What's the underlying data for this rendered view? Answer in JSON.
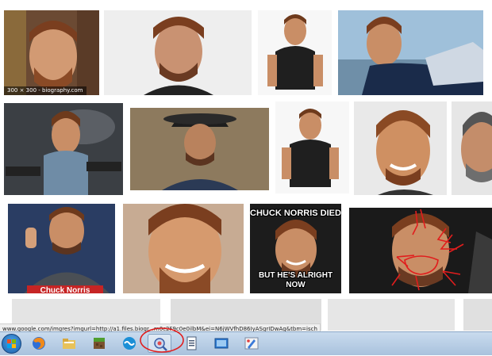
{
  "results": [
    {
      "id": "result-1",
      "caption": "300 × 300 - biography.com"
    },
    {
      "id": "result-2"
    },
    {
      "id": "result-3"
    },
    {
      "id": "result-4"
    },
    {
      "id": "result-5"
    },
    {
      "id": "result-6"
    },
    {
      "id": "result-7"
    },
    {
      "id": "result-8"
    },
    {
      "id": "result-9"
    },
    {
      "id": "result-10",
      "label": "Chuck Norris"
    },
    {
      "id": "result-11"
    },
    {
      "id": "result-12",
      "top_text": "CHUCK NORRIS DIED",
      "bottom_text_1": "BUT HE'S ALRIGHT",
      "bottom_text_2": "NOW"
    },
    {
      "id": "result-13"
    }
  ],
  "status_bar": {
    "url": "www.google.com/imgres?imgurl=http://a1.files.biogr...m0c2F9c0e0ilbM&ei=N6jWVfhD86IyASgrIDwAg&tbm=isch"
  },
  "taskbar": {
    "items": [
      {
        "name": "start-button"
      },
      {
        "name": "firefox-icon"
      },
      {
        "name": "file-manager-icon"
      },
      {
        "name": "minecraft-icon"
      },
      {
        "name": "app-wave-icon"
      },
      {
        "name": "image-viewer-icon",
        "active": true
      },
      {
        "name": "document-icon"
      },
      {
        "name": "screenshot-icon"
      },
      {
        "name": "paint-icon"
      }
    ]
  },
  "colors": {
    "annotation_red": "#e11d1d",
    "taskbar_top": "#c9dbee",
    "taskbar_bottom": "#a9c2dd"
  }
}
